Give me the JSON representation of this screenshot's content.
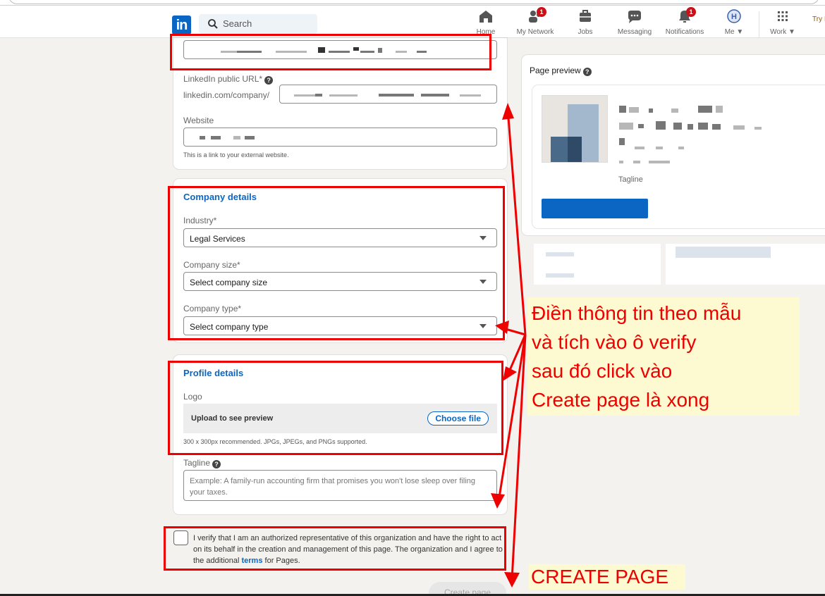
{
  "nav": {
    "logo": "in",
    "search_placeholder": "Search",
    "items": [
      {
        "label": "Home",
        "badge": ""
      },
      {
        "label": "My Network",
        "badge": "1"
      },
      {
        "label": "Jobs",
        "badge": ""
      },
      {
        "label": "Messaging",
        "badge": ""
      },
      {
        "label": "Notifications",
        "badge": "1"
      },
      {
        "label": "Me",
        "badge": ""
      },
      {
        "label": "Work",
        "badge": ""
      }
    ],
    "try_text": "Try I"
  },
  "form": {
    "url_label": "LinkedIn public URL*",
    "url_prefix": "linkedin.com/company/",
    "website_label": "Website",
    "website_hint": "This is a link to your external website.",
    "company_details_title": "Company details",
    "industry_label": "Industry*",
    "industry_value": "Legal Services",
    "size_label": "Company size*",
    "size_value": "Select company size",
    "type_label": "Company type*",
    "type_value": "Select company type",
    "profile_details_title": "Profile details",
    "logo_label": "Logo",
    "upload_text": "Upload to see preview",
    "choose_file": "Choose file",
    "logo_hint": "300 x 300px recommended. JPGs, JPEGs, and PNGs supported.",
    "tagline_label": "Tagline",
    "tagline_placeholder": "Example: A family-run accounting firm that promises you won't lose sleep over filing your taxes.",
    "verify_text_before": "I verify that I am an authorized representative of this organization and have the right to act on its behalf in the creation and management of this page. The organization and I agree to the additional ",
    "verify_link": "terms",
    "verify_text_after": " for Pages.",
    "create_button": "Create page"
  },
  "preview": {
    "title": "Page preview",
    "tagline": "Tagline",
    "logo_colors": {
      "background": "#e8e4df",
      "light": "#a3b8cc",
      "dark": "#4a6a8a"
    }
  },
  "annotations": {
    "note_lines": [
      "Điền thông tin theo mẫu",
      "và tích vào ô verify",
      "sau đó click vào",
      "Create page là xong"
    ],
    "note2": "CREATE PAGE",
    "color": "#ee0000",
    "highlight": "#fdf9d0"
  }
}
